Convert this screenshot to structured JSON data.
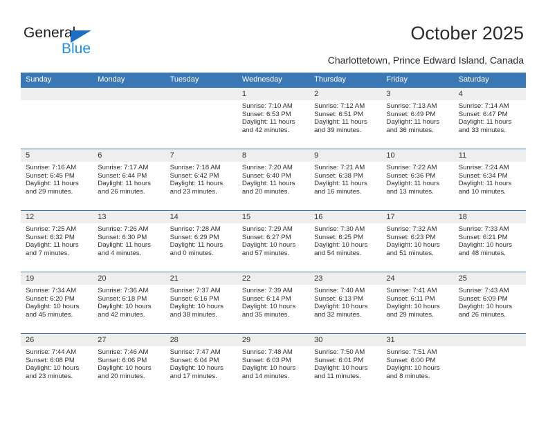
{
  "brand": {
    "name_top": "General",
    "name_bottom": "Blue",
    "triangle_color": "#1f6fc0",
    "blue_text_color": "#1f8fe0"
  },
  "header": {
    "title": "October 2025",
    "subtitle": "Charlottetown, Prince Edward Island, Canada"
  },
  "theme": {
    "header_bg": "#3a77b5",
    "daynum_bg": "#eeeeee",
    "cell_bg": "#ffffff",
    "text": "#2d2d2d"
  },
  "weekdays": [
    "Sunday",
    "Monday",
    "Tuesday",
    "Wednesday",
    "Thursday",
    "Friday",
    "Saturday"
  ],
  "weeks": [
    [
      {
        "day": "",
        "lines": []
      },
      {
        "day": "",
        "lines": []
      },
      {
        "day": "",
        "lines": []
      },
      {
        "day": "1",
        "lines": [
          "Sunrise: 7:10 AM",
          "Sunset: 6:53 PM",
          "Daylight: 11 hours",
          "and 42 minutes."
        ]
      },
      {
        "day": "2",
        "lines": [
          "Sunrise: 7:12 AM",
          "Sunset: 6:51 PM",
          "Daylight: 11 hours",
          "and 39 minutes."
        ]
      },
      {
        "day": "3",
        "lines": [
          "Sunrise: 7:13 AM",
          "Sunset: 6:49 PM",
          "Daylight: 11 hours",
          "and 36 minutes."
        ]
      },
      {
        "day": "4",
        "lines": [
          "Sunrise: 7:14 AM",
          "Sunset: 6:47 PM",
          "Daylight: 11 hours",
          "and 33 minutes."
        ]
      }
    ],
    [
      {
        "day": "5",
        "lines": [
          "Sunrise: 7:16 AM",
          "Sunset: 6:45 PM",
          "Daylight: 11 hours",
          "and 29 minutes."
        ]
      },
      {
        "day": "6",
        "lines": [
          "Sunrise: 7:17 AM",
          "Sunset: 6:44 PM",
          "Daylight: 11 hours",
          "and 26 minutes."
        ]
      },
      {
        "day": "7",
        "lines": [
          "Sunrise: 7:18 AM",
          "Sunset: 6:42 PM",
          "Daylight: 11 hours",
          "and 23 minutes."
        ]
      },
      {
        "day": "8",
        "lines": [
          "Sunrise: 7:20 AM",
          "Sunset: 6:40 PM",
          "Daylight: 11 hours",
          "and 20 minutes."
        ]
      },
      {
        "day": "9",
        "lines": [
          "Sunrise: 7:21 AM",
          "Sunset: 6:38 PM",
          "Daylight: 11 hours",
          "and 16 minutes."
        ]
      },
      {
        "day": "10",
        "lines": [
          "Sunrise: 7:22 AM",
          "Sunset: 6:36 PM",
          "Daylight: 11 hours",
          "and 13 minutes."
        ]
      },
      {
        "day": "11",
        "lines": [
          "Sunrise: 7:24 AM",
          "Sunset: 6:34 PM",
          "Daylight: 11 hours",
          "and 10 minutes."
        ]
      }
    ],
    [
      {
        "day": "12",
        "lines": [
          "Sunrise: 7:25 AM",
          "Sunset: 6:32 PM",
          "Daylight: 11 hours",
          "and 7 minutes."
        ]
      },
      {
        "day": "13",
        "lines": [
          "Sunrise: 7:26 AM",
          "Sunset: 6:30 PM",
          "Daylight: 11 hours",
          "and 4 minutes."
        ]
      },
      {
        "day": "14",
        "lines": [
          "Sunrise: 7:28 AM",
          "Sunset: 6:29 PM",
          "Daylight: 11 hours",
          "and 0 minutes."
        ]
      },
      {
        "day": "15",
        "lines": [
          "Sunrise: 7:29 AM",
          "Sunset: 6:27 PM",
          "Daylight: 10 hours",
          "and 57 minutes."
        ]
      },
      {
        "day": "16",
        "lines": [
          "Sunrise: 7:30 AM",
          "Sunset: 6:25 PM",
          "Daylight: 10 hours",
          "and 54 minutes."
        ]
      },
      {
        "day": "17",
        "lines": [
          "Sunrise: 7:32 AM",
          "Sunset: 6:23 PM",
          "Daylight: 10 hours",
          "and 51 minutes."
        ]
      },
      {
        "day": "18",
        "lines": [
          "Sunrise: 7:33 AM",
          "Sunset: 6:21 PM",
          "Daylight: 10 hours",
          "and 48 minutes."
        ]
      }
    ],
    [
      {
        "day": "19",
        "lines": [
          "Sunrise: 7:34 AM",
          "Sunset: 6:20 PM",
          "Daylight: 10 hours",
          "and 45 minutes."
        ]
      },
      {
        "day": "20",
        "lines": [
          "Sunrise: 7:36 AM",
          "Sunset: 6:18 PM",
          "Daylight: 10 hours",
          "and 42 minutes."
        ]
      },
      {
        "day": "21",
        "lines": [
          "Sunrise: 7:37 AM",
          "Sunset: 6:16 PM",
          "Daylight: 10 hours",
          "and 38 minutes."
        ]
      },
      {
        "day": "22",
        "lines": [
          "Sunrise: 7:39 AM",
          "Sunset: 6:14 PM",
          "Daylight: 10 hours",
          "and 35 minutes."
        ]
      },
      {
        "day": "23",
        "lines": [
          "Sunrise: 7:40 AM",
          "Sunset: 6:13 PM",
          "Daylight: 10 hours",
          "and 32 minutes."
        ]
      },
      {
        "day": "24",
        "lines": [
          "Sunrise: 7:41 AM",
          "Sunset: 6:11 PM",
          "Daylight: 10 hours",
          "and 29 minutes."
        ]
      },
      {
        "day": "25",
        "lines": [
          "Sunrise: 7:43 AM",
          "Sunset: 6:09 PM",
          "Daylight: 10 hours",
          "and 26 minutes."
        ]
      }
    ],
    [
      {
        "day": "26",
        "lines": [
          "Sunrise: 7:44 AM",
          "Sunset: 6:08 PM",
          "Daylight: 10 hours",
          "and 23 minutes."
        ]
      },
      {
        "day": "27",
        "lines": [
          "Sunrise: 7:46 AM",
          "Sunset: 6:06 PM",
          "Daylight: 10 hours",
          "and 20 minutes."
        ]
      },
      {
        "day": "28",
        "lines": [
          "Sunrise: 7:47 AM",
          "Sunset: 6:04 PM",
          "Daylight: 10 hours",
          "and 17 minutes."
        ]
      },
      {
        "day": "29",
        "lines": [
          "Sunrise: 7:48 AM",
          "Sunset: 6:03 PM",
          "Daylight: 10 hours",
          "and 14 minutes."
        ]
      },
      {
        "day": "30",
        "lines": [
          "Sunrise: 7:50 AM",
          "Sunset: 6:01 PM",
          "Daylight: 10 hours",
          "and 11 minutes."
        ]
      },
      {
        "day": "31",
        "lines": [
          "Sunrise: 7:51 AM",
          "Sunset: 6:00 PM",
          "Daylight: 10 hours",
          "and 8 minutes."
        ]
      },
      {
        "day": "",
        "lines": []
      }
    ]
  ]
}
